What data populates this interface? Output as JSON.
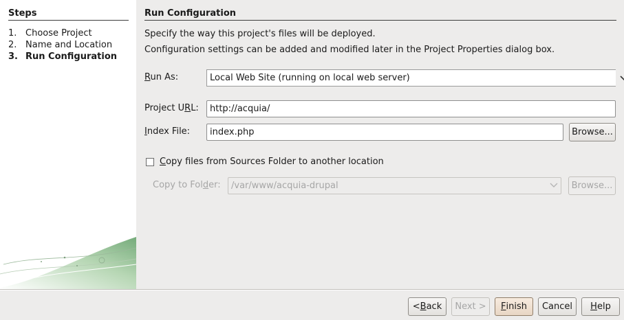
{
  "steps": {
    "title": "Steps",
    "items": [
      {
        "num": "1.",
        "label": "Choose Project"
      },
      {
        "num": "2.",
        "label": "Name and Location"
      },
      {
        "num": "3.",
        "label": "Run Configuration"
      }
    ]
  },
  "main": {
    "title": "Run Configuration",
    "desc1": "Specify the way this project's files will be deployed.",
    "desc2": "Configuration settings can be added and modified later in the Project Properties dialog box.",
    "run_as": {
      "label_pre": "",
      "label_mn": "R",
      "label_post": "un As:",
      "value": "Local Web Site (running on local web server)"
    },
    "project_url": {
      "label_pre": "Project U",
      "label_mn": "R",
      "label_post": "L:",
      "value": "http://acquia/"
    },
    "index_file": {
      "label_pre": "",
      "label_mn": "I",
      "label_post": "ndex File:",
      "value": "index.php"
    },
    "browse_label": "Browse...",
    "copy_files": {
      "label_pre": "",
      "label_mn": "C",
      "label_post": "opy files from Sources Folder to another location",
      "checked": false
    },
    "copy_to": {
      "label_pre": "Copy to Fol",
      "label_mn": "d",
      "label_post": "er:",
      "value": "/var/www/acquia-drupal"
    },
    "browse2_label": "Browse..."
  },
  "footer": {
    "back": {
      "pre": "< ",
      "mn": "B",
      "post": "ack"
    },
    "next": "Next >",
    "finish": {
      "pre": "",
      "mn": "F",
      "post": "inish"
    },
    "cancel": "Cancel",
    "help": {
      "pre": "",
      "mn": "H",
      "post": "elp"
    }
  }
}
